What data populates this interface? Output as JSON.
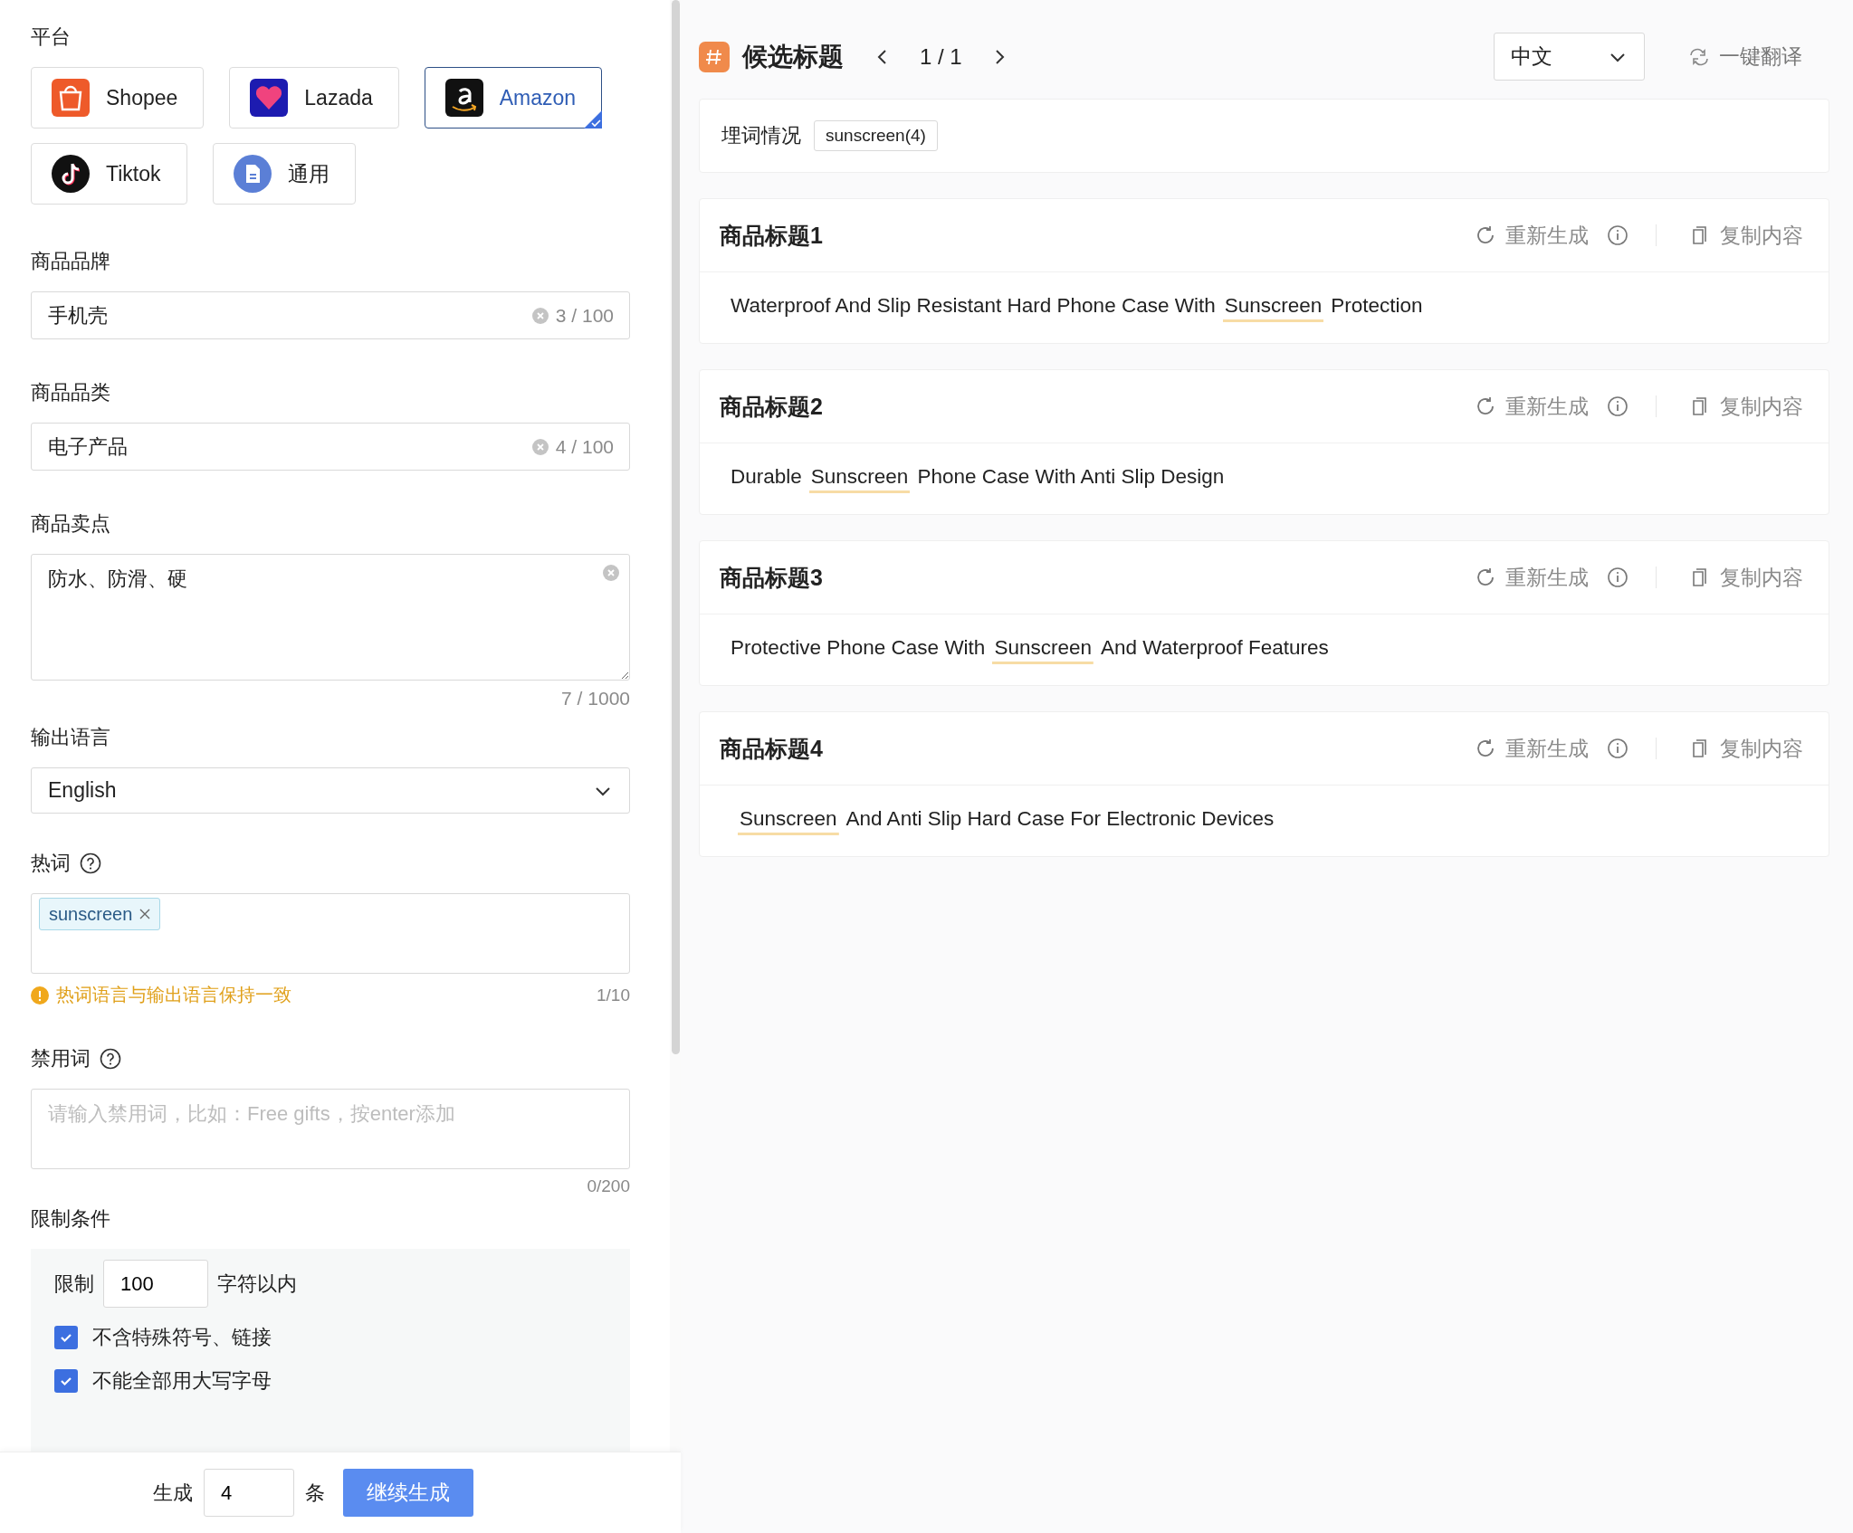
{
  "platform": {
    "label": "平台",
    "options": [
      {
        "name": "Shopee",
        "kind": "shopee",
        "selected": false
      },
      {
        "name": "Lazada",
        "kind": "lazada",
        "selected": false
      },
      {
        "name": "Amazon",
        "kind": "amazon",
        "selected": true
      },
      {
        "name": "Tiktok",
        "kind": "tiktok",
        "selected": false
      },
      {
        "name": "通用",
        "kind": "generic",
        "selected": false
      }
    ]
  },
  "brand": {
    "label": "商品品牌",
    "value": "手机壳",
    "count": "3 / 100"
  },
  "category": {
    "label": "商品品类",
    "value": "电子产品",
    "count": "4 / 100"
  },
  "selling_points": {
    "label": "商品卖点",
    "value": "防水、防滑、硬",
    "count": "7 / 1000"
  },
  "output_language": {
    "label": "输出语言",
    "value": "English"
  },
  "hot_words": {
    "label": "热词",
    "tags": [
      "sunscreen"
    ],
    "warning": "热词语言与输出语言保持一致",
    "count": "1/10"
  },
  "banned_words": {
    "label": "禁用词",
    "placeholder": "请输入禁用词，比如：Free gifts，按enter添加",
    "count": "0/200"
  },
  "constraints": {
    "label": "限制条件",
    "limit_prefix": "限制",
    "limit_value": "100",
    "limit_suffix": "字符以内",
    "options": [
      {
        "label": "不含特殊符号、链接",
        "checked": true
      },
      {
        "label": "不能全部用大写字母",
        "checked": true
      }
    ]
  },
  "footer": {
    "prefix": "生成",
    "count": "4",
    "suffix": "条",
    "button": "继续生成"
  },
  "results": {
    "title": "候选标题",
    "pager": "1 / 1",
    "language": "中文",
    "translate": "一键翻译",
    "keyword_label": "埋词情况",
    "keyword_tags": [
      "sunscreen(4)"
    ],
    "titles": [
      {
        "heading": "商品标题1",
        "regenerate": "重新生成",
        "copy": "复制内容",
        "parts": [
          {
            "text": "Waterproof And Slip Resistant Hard Phone Case With",
            "keyword": false
          },
          {
            "text": "Sunscreen",
            "keyword": true
          },
          {
            "text": "Protection",
            "keyword": false
          }
        ]
      },
      {
        "heading": "商品标题2",
        "regenerate": "重新生成",
        "copy": "复制内容",
        "parts": [
          {
            "text": "Durable",
            "keyword": false
          },
          {
            "text": "Sunscreen",
            "keyword": true
          },
          {
            "text": "Phone Case With Anti Slip Design",
            "keyword": false
          }
        ]
      },
      {
        "heading": "商品标题3",
        "regenerate": "重新生成",
        "copy": "复制内容",
        "parts": [
          {
            "text": "Protective Phone Case With",
            "keyword": false
          },
          {
            "text": "Sunscreen",
            "keyword": true
          },
          {
            "text": "And Waterproof Features",
            "keyword": false
          }
        ]
      },
      {
        "heading": "商品标题4",
        "regenerate": "重新生成",
        "copy": "复制内容",
        "parts": [
          {
            "text": "Sunscreen",
            "keyword": true
          },
          {
            "text": "And Anti Slip Hard Case For Electronic Devices",
            "keyword": false
          }
        ]
      }
    ]
  }
}
